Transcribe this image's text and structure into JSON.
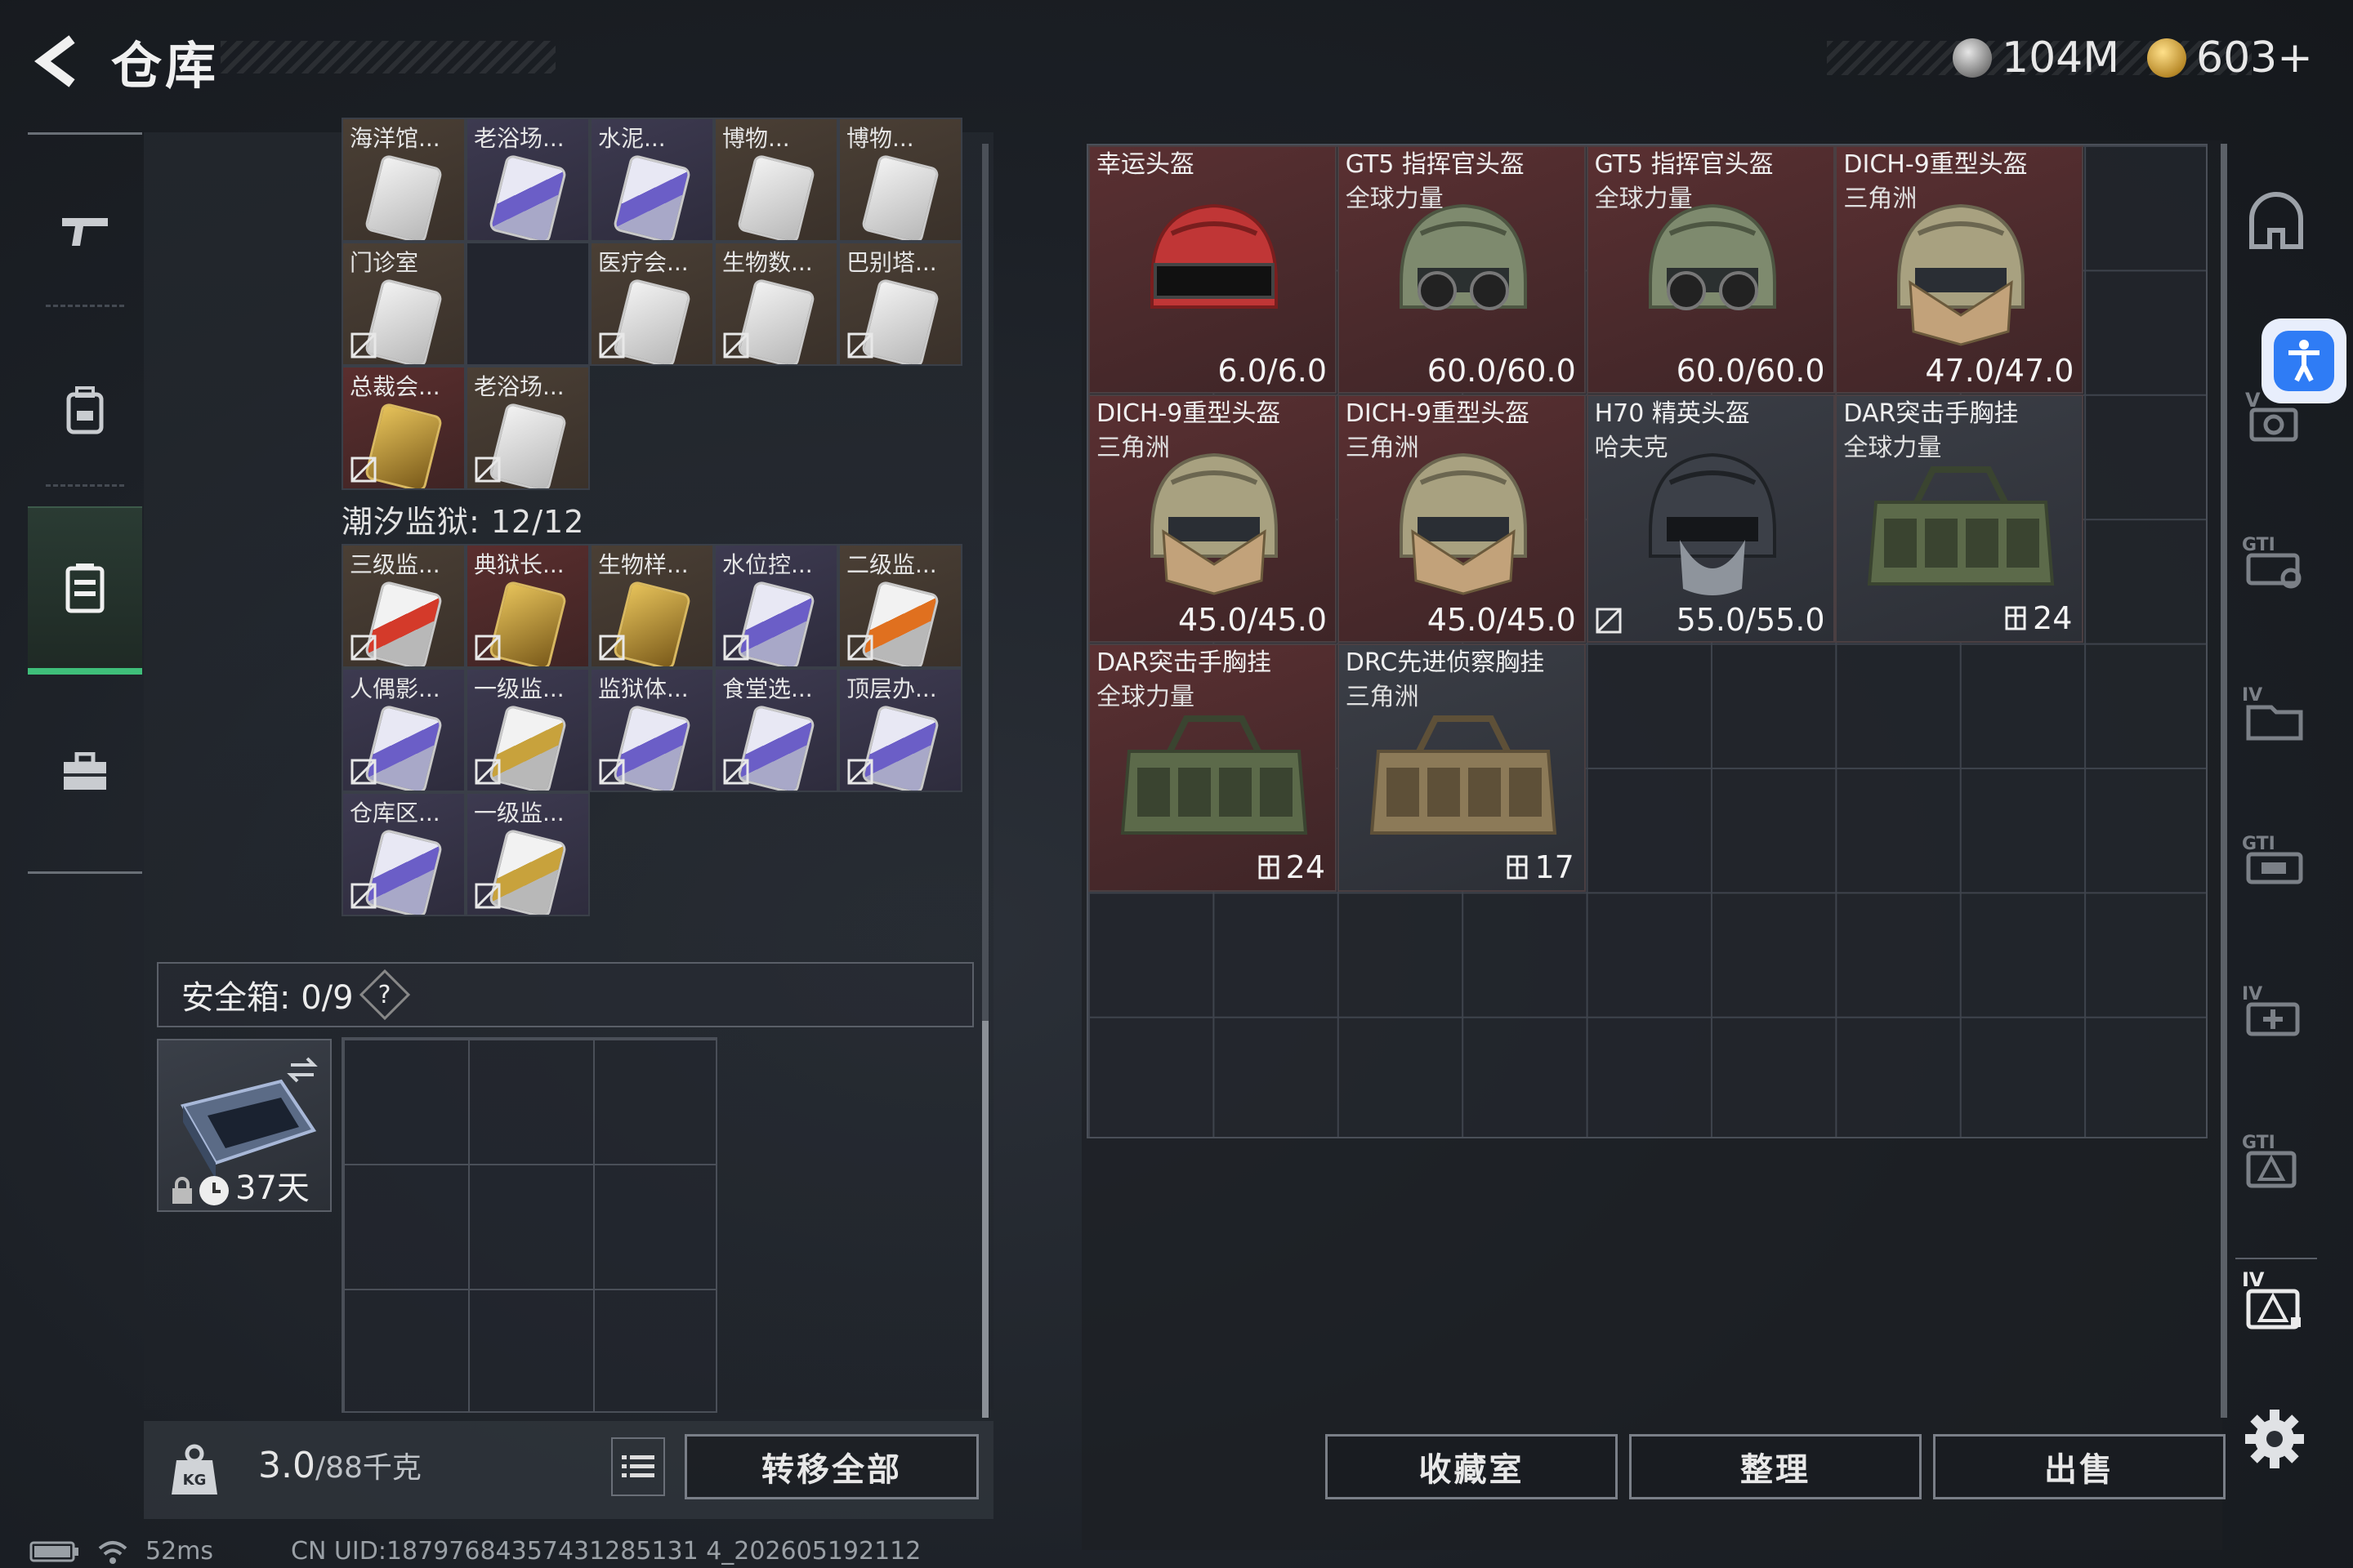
{
  "header": {
    "title": "仓库",
    "currency_silver": "104M",
    "currency_gold": "603+"
  },
  "nav": {
    "items": [
      "weapon-icon",
      "backpack-icon",
      "vest-icon",
      "toolbox-icon"
    ],
    "active_index": 2
  },
  "inventory": {
    "top_row1": [
      {
        "label": "海洋馆...",
        "kind": "keycard",
        "color": "brown"
      },
      {
        "label": "老浴场...",
        "kind": "keycard",
        "color": "purple"
      },
      {
        "label": "水泥...",
        "kind": "keycard",
        "color": "purple"
      },
      {
        "label": "博物...",
        "kind": "keycard",
        "color": "brown"
      },
      {
        "label": "博物...",
        "kind": "keycard",
        "color": "brown"
      }
    ],
    "top_row2": [
      {
        "label": "门诊室",
        "color": "brown"
      },
      {
        "label": "",
        "color": "empty"
      },
      {
        "label": "医疗会...",
        "color": "brown"
      },
      {
        "label": "生物数...",
        "color": "brown"
      },
      {
        "label": "巴别塔...",
        "color": "brown"
      }
    ],
    "top_row3": [
      {
        "label": "总裁会...",
        "color": "red"
      },
      {
        "label": "老浴场...",
        "color": "brown"
      }
    ],
    "prison_section": "潮汐监狱: 12/12",
    "prison_row1": [
      {
        "label": "三级监...",
        "color": "brown"
      },
      {
        "label": "典狱长...",
        "color": "red"
      },
      {
        "label": "生物样...",
        "color": "brown"
      },
      {
        "label": "水位控...",
        "color": "purple"
      },
      {
        "label": "二级监...",
        "color": "brown"
      }
    ],
    "prison_row2": [
      {
        "label": "人偶影...",
        "color": "purple"
      },
      {
        "label": "一级监...",
        "color": "purple"
      },
      {
        "label": "监狱体...",
        "color": "purple"
      },
      {
        "label": "食堂选...",
        "color": "purple"
      },
      {
        "label": "顶层办...",
        "color": "purple"
      }
    ],
    "prison_row3": [
      {
        "label": "仓库区...",
        "color": "purple"
      },
      {
        "label": "一级监...",
        "color": "purple"
      }
    ]
  },
  "safe_box": {
    "label": "安全箱: 0/9",
    "help": "?",
    "expiry": "37天"
  },
  "footer_left": {
    "weight_value": "3.0",
    "weight_capacity": "/88千克",
    "transfer_all": "转移全部"
  },
  "status": {
    "ping": "52ms",
    "uid": "CN UID:18797684357431285131 4_202605192112"
  },
  "stash": {
    "items": [
      {
        "name": "幸运头盔",
        "sub": "",
        "stat": "6.0/6.0",
        "type": "helmet",
        "variant": "red-visor"
      },
      {
        "name": "GT5 指挥官头盔",
        "sub": "全球力量",
        "stat": "60.0/60.0",
        "type": "helmet",
        "variant": "gt5"
      },
      {
        "name": "GT5 指挥官头盔",
        "sub": "全球力量",
        "stat": "60.0/60.0",
        "type": "helmet",
        "variant": "gt5"
      },
      {
        "name": "DICH-9重型头盔",
        "sub": "三角洲",
        "stat": "47.0/47.0",
        "type": "helmet",
        "variant": "dich"
      },
      {
        "name": "DICH-9重型头盔",
        "sub": "三角洲",
        "stat": "45.0/45.0",
        "type": "helmet",
        "variant": "dich"
      },
      {
        "name": "DICH-9重型头盔",
        "sub": "三角洲",
        "stat": "45.0/45.0",
        "type": "helmet",
        "variant": "dich"
      },
      {
        "name": "H70 精英头盔",
        "sub": "哈夫克",
        "stat": "55.0/55.0",
        "type": "helmet",
        "variant": "h70"
      },
      {
        "name": "DAR突击手胸挂",
        "sub": "全球力量",
        "stat": "24",
        "type": "vest",
        "variant": "green"
      },
      {
        "name": "DAR突击手胸挂",
        "sub": "全球力量",
        "stat": "24",
        "type": "vest",
        "variant": "green"
      },
      {
        "name": "DRC先进侦察胸挂",
        "sub": "三角洲",
        "stat": "17",
        "type": "vest",
        "variant": "tan"
      }
    ],
    "buttons": {
      "collection": "收藏室",
      "sort": "整理",
      "sell": "出售"
    }
  },
  "side_tabs": [
    "helmet-tab-icon",
    "V-tab-icon",
    "GTI-tab-icon",
    "IV-tab-icon",
    "GTI2-tab-icon",
    "IV2-tab-icon",
    "GTI3-tab-icon",
    "IV3-tab-icon"
  ],
  "colors": {
    "accent_green": "#3fbf7a",
    "item_red": "#5a3032",
    "item_brown": "#4a3f35",
    "item_purple": "#3d3a50",
    "accessibility_blue": "#2f7cf5"
  }
}
